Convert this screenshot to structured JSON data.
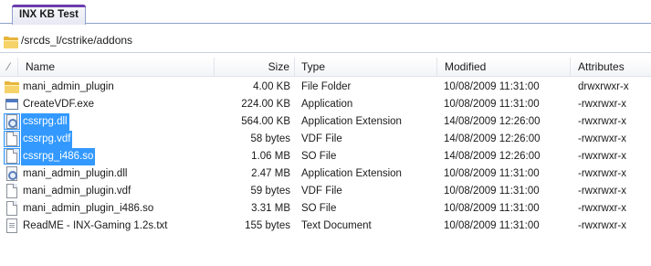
{
  "tab": {
    "label": "INX KB Test"
  },
  "path": {
    "text": "/srcds_l/cstrike/addons"
  },
  "columns": {
    "sort_indicator": "⁄",
    "name": "Name",
    "size": "Size",
    "type": "Type",
    "modified": "Modified",
    "attributes": "Attributes"
  },
  "files": [
    {
      "name": "mani_admin_plugin",
      "size": "4.00 KB",
      "type": "File Folder",
      "modified": "10/08/2009 11:31:00",
      "attributes": "drwxrwxr-x",
      "icon": "folder-icon",
      "selected": false
    },
    {
      "name": "CreateVDF.exe",
      "size": "224.00 KB",
      "type": "Application",
      "modified": "10/08/2009 11:31:00",
      "attributes": "-rwxrwxr-x",
      "icon": "exe-icon",
      "selected": false
    },
    {
      "name": "cssrpg.dll",
      "size": "564.00 KB",
      "type": "Application Extension",
      "modified": "14/08/2009 12:26:00",
      "attributes": "-rwxrwxr-x",
      "icon": "dll-icon",
      "selected": true
    },
    {
      "name": "cssrpg.vdf",
      "size": "58 bytes",
      "type": "VDF File",
      "modified": "14/08/2009 12:26:00",
      "attributes": "-rwxrwxr-x",
      "icon": "file-icon",
      "selected": true
    },
    {
      "name": "cssrpg_i486.so",
      "size": "1.06 MB",
      "type": "SO File",
      "modified": "14/08/2009 12:26:00",
      "attributes": "-rwxrwxr-x",
      "icon": "file-icon",
      "selected": true
    },
    {
      "name": "mani_admin_plugin.dll",
      "size": "2.47 MB",
      "type": "Application Extension",
      "modified": "10/08/2009 11:31:00",
      "attributes": "-rwxrwxr-x",
      "icon": "dll-icon",
      "selected": false
    },
    {
      "name": "mani_admin_plugin.vdf",
      "size": "59 bytes",
      "type": "VDF File",
      "modified": "10/08/2009 11:31:00",
      "attributes": "-rwxrwxr-x",
      "icon": "file-icon",
      "selected": false
    },
    {
      "name": "mani_admin_plugin_i486.so",
      "size": "3.31 MB",
      "type": "SO File",
      "modified": "10/08/2009 11:31:00",
      "attributes": "-rwxrwxr-x",
      "icon": "file-icon",
      "selected": false
    },
    {
      "name": "ReadME - INX-Gaming 1.2s.txt",
      "size": "155 bytes",
      "type": "Text Document",
      "modified": "10/08/2009 11:31:00",
      "attributes": "-rwxrwxr-x",
      "icon": "text-file-icon",
      "selected": false
    }
  ],
  "colors": {
    "selection": "#3399ff",
    "tab_accent": "#6b3cad",
    "folder": "#e7b53c"
  }
}
